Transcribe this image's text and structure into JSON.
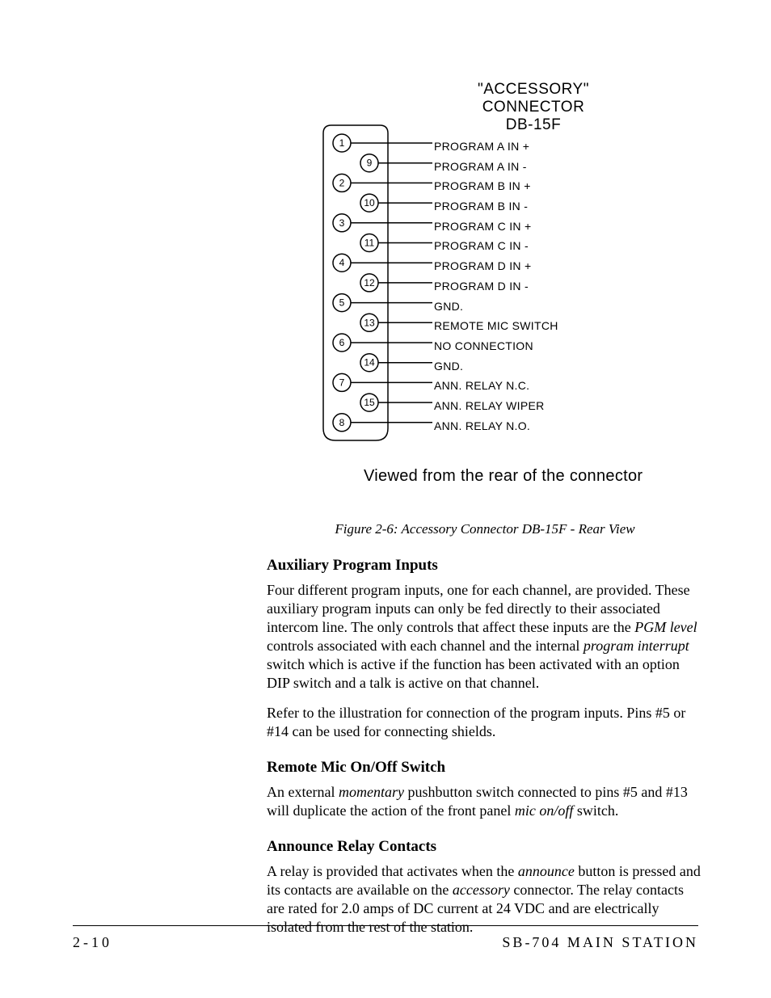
{
  "connector": {
    "title_line1": "\"ACCESSORY\"",
    "title_line2": "CONNECTOR",
    "title_line3": "DB-15F",
    "view_note": "Viewed from the rear of the connector",
    "pins": [
      {
        "num": "1",
        "label": "PROGRAM A IN +"
      },
      {
        "num": "9",
        "label": "PROGRAM A IN -"
      },
      {
        "num": "2",
        "label": "PROGRAM B IN +"
      },
      {
        "num": "10",
        "label": "PROGRAM B IN -"
      },
      {
        "num": "3",
        "label": "PROGRAM C IN +"
      },
      {
        "num": "11",
        "label": "PROGRAM C IN -"
      },
      {
        "num": "4",
        "label": "PROGRAM D IN +"
      },
      {
        "num": "12",
        "label": "PROGRAM D IN -"
      },
      {
        "num": "5",
        "label": "GND."
      },
      {
        "num": "13",
        "label": "REMOTE MIC SWITCH"
      },
      {
        "num": "6",
        "label": "NO CONNECTION"
      },
      {
        "num": "14",
        "label": "GND."
      },
      {
        "num": "7",
        "label": "ANN. RELAY N.C."
      },
      {
        "num": "15",
        "label": "ANN. RELAY WIPER"
      },
      {
        "num": "8",
        "label": "ANN. RELAY N.O."
      }
    ]
  },
  "caption": "Figure 2-6: Accessory Connector DB-15F - Rear View",
  "sections": {
    "aux": {
      "heading": "Auxiliary Program Inputs",
      "p1_a": "Four different program inputs, one for each channel, are provided. These auxiliary program inputs can only be fed directly to their associated intercom line. The only controls that affect these inputs are the ",
      "p1_em1": "PGM level",
      "p1_b": " controls associated with each channel and the internal ",
      "p1_em2": "program interrupt",
      "p1_c": " switch which is active if the function has been activated with an option DIP switch and a talk is active on that channel.",
      "p2": "Refer to the illustration for connection of the program inputs. Pins #5 or #14 can be used for connecting shields."
    },
    "mic": {
      "heading": "Remote Mic On/Off Switch",
      "p1_a": "An external ",
      "p1_em1": "momentary",
      "p1_b": " pushbutton switch connected to pins #5 and #13 will duplicate the action of the front panel ",
      "p1_em2": "mic on/off",
      "p1_c": " switch."
    },
    "ann": {
      "heading": "Announce Relay Contacts",
      "p1_a": "A relay is provided that activates when the ",
      "p1_em1": "announce",
      "p1_b": " button is pressed and its contacts are available on the ",
      "p1_em2": "accessory",
      "p1_c": " connector. The relay contacts are rated for 2.0 amps of DC current at 24 VDC and are electrically isolated from the rest of the station."
    }
  },
  "footer": {
    "left": "2-10",
    "right": "SB-704 MAIN STATION"
  }
}
